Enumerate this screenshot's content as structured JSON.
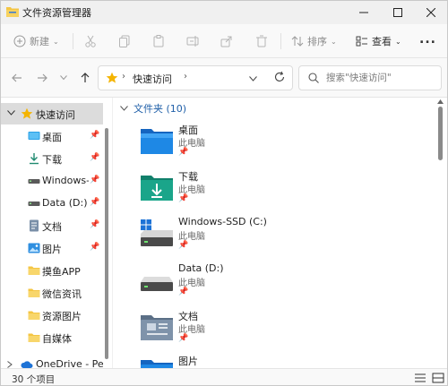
{
  "window": {
    "title": "文件资源管理器"
  },
  "toolbar": {
    "new_label": "新建",
    "sort_label": "排序",
    "view_label": "查看",
    "more_label": "..."
  },
  "address": {
    "crumb": "快速访问",
    "separator": "›"
  },
  "search": {
    "placeholder": "搜索\"快速访问\""
  },
  "sidebar": {
    "quick_access": "快速访问",
    "items": [
      {
        "label": "桌面",
        "icon": "desktop-icon",
        "pinned": true
      },
      {
        "label": "下载",
        "icon": "download-icon",
        "pinned": true
      },
      {
        "label": "Windows-S",
        "icon": "drive-icon",
        "pinned": true
      },
      {
        "label": "Data (D:)",
        "icon": "drive-icon",
        "pinned": true
      },
      {
        "label": "文档",
        "icon": "document-icon",
        "pinned": true
      },
      {
        "label": "图片",
        "icon": "pictures-icon",
        "pinned": true
      },
      {
        "label": "摸鱼APP",
        "icon": "folder-icon",
        "pinned": false
      },
      {
        "label": "微信资讯",
        "icon": "folder-icon",
        "pinned": false
      },
      {
        "label": "资源图片",
        "icon": "folder-icon",
        "pinned": false
      },
      {
        "label": "自媒体",
        "icon": "folder-icon",
        "pinned": false
      }
    ],
    "onedrive": "OneDrive - Pers"
  },
  "content": {
    "section_title": "文件夹 (10)",
    "tiles": [
      {
        "name": "桌面",
        "sub": "此电脑",
        "icon": "desktop-folder-icon"
      },
      {
        "name": "下载",
        "sub": "此电脑",
        "icon": "download-folder-icon"
      },
      {
        "name": "Windows-SSD (C:)",
        "sub": "此电脑",
        "icon": "windows-drive-icon"
      },
      {
        "name": "Data (D:)",
        "sub": "此电脑",
        "icon": "data-drive-icon"
      },
      {
        "name": "文档",
        "sub": "此电脑",
        "icon": "documents-folder-icon"
      },
      {
        "name": "图片",
        "sub": "",
        "icon": "pictures-folder-icon"
      }
    ]
  },
  "status": {
    "count": "30 个项目"
  },
  "colors": {
    "accent": "#1f5fa8",
    "folder_yellow": "#f4c542",
    "folder_blue": "#1e88d8",
    "folder_green": "#1aa58a"
  }
}
